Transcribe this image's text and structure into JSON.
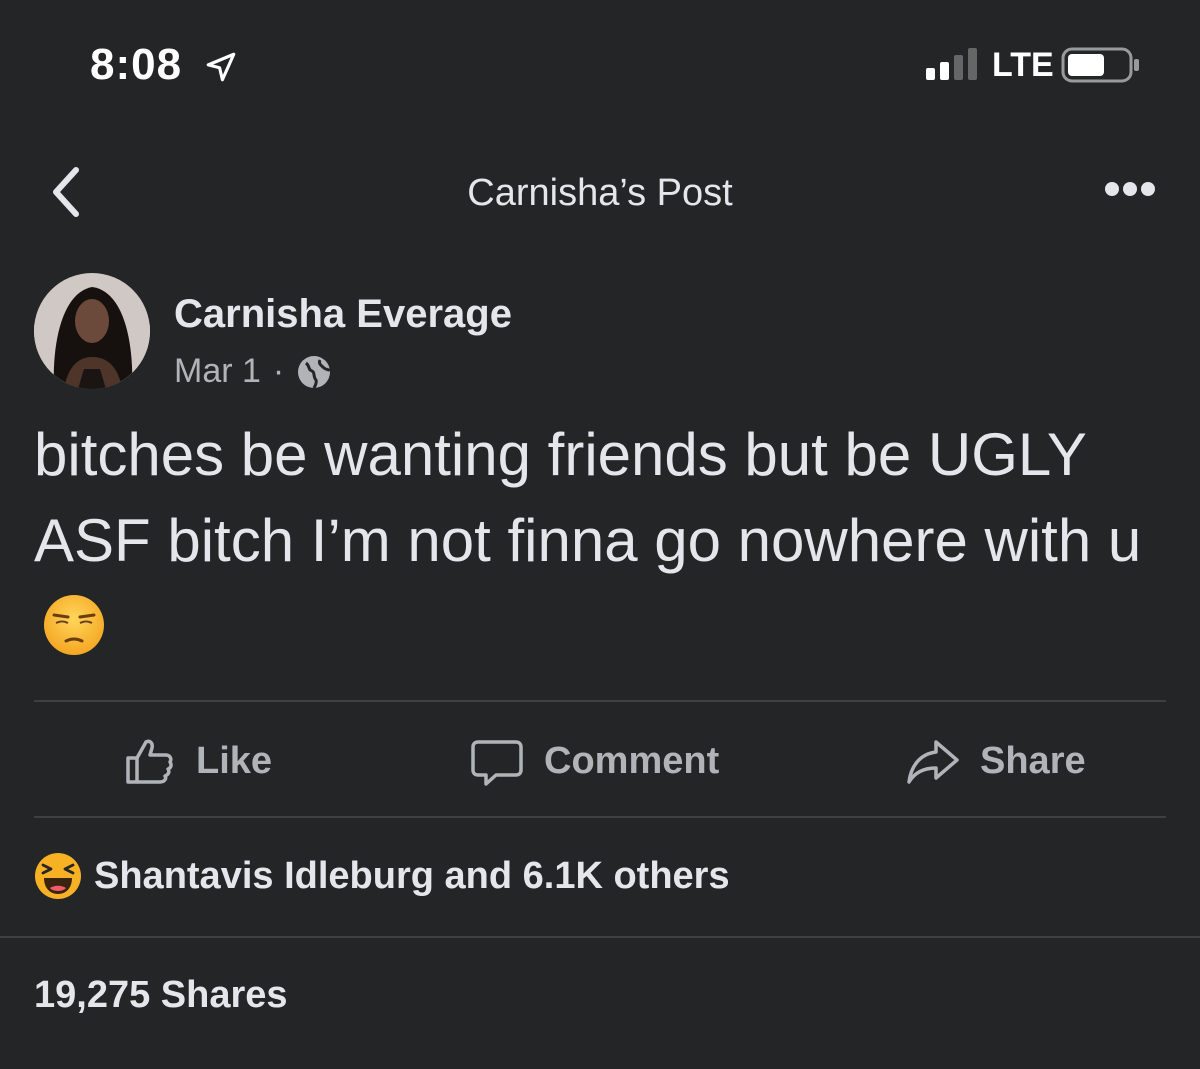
{
  "status_bar": {
    "time": "8:08",
    "network": "LTE",
    "location_icon": "location-arrow-icon",
    "signal_icon": "cellular-signal-icon",
    "battery_icon": "battery-icon"
  },
  "nav": {
    "title": "Carnisha’s Post",
    "back_icon": "chevron-left-icon",
    "more_icon": "more-dots-icon"
  },
  "post": {
    "author": "Carnisha Everage",
    "date": "Mar 1",
    "separator": "·",
    "privacy_icon": "globe-icon",
    "text": "bitches be wanting friends but be UGLY ASF bitch I’m not finna go nowhere with u",
    "text_emoji": "unamused-face-emoji"
  },
  "actions": {
    "like_label": "Like",
    "comment_label": "Comment",
    "share_label": "Share"
  },
  "reactions": {
    "icon": "haha-reaction-icon",
    "summary": "Shantavis Idleburg and 6.1K others"
  },
  "shares_count": "19,275 Shares",
  "colors": {
    "background": "#242526",
    "primary_text": "#e4e6eb",
    "secondary_text": "#b0b3b8",
    "divider": "#3e4042",
    "emoji_yellow": "#f7b125"
  }
}
